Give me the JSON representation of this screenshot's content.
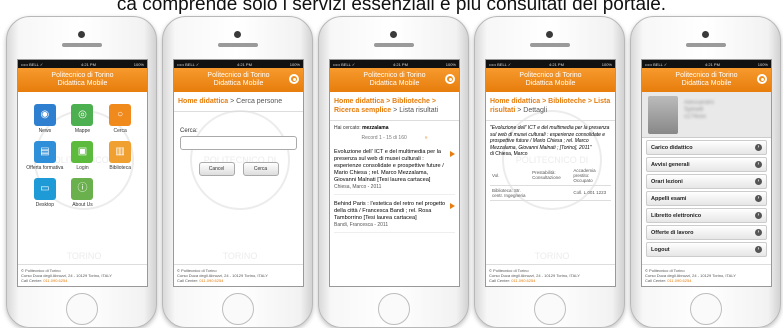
{
  "caption": "ca comprende solo i servizi essenziali e più consultati del portale.",
  "app": {
    "title_line1": "Politecnico di Torino",
    "title_line2": "Didattica Mobile"
  },
  "watermark": "POLITECNICO DI TORINO",
  "footer": {
    "line1": "© Politecnico di Torino",
    "line2": "Corso Duca degli Abruzzi, 24 - 10129 Torino, ITALY",
    "call_label": "Call Center:",
    "call_number": "011.090.6254"
  },
  "status": [
    {
      "carrier": "••••• BELL ✓",
      "time": "4:21 PM",
      "battery": "100%"
    },
    {
      "carrier": "••••• BELL ✓",
      "time": "4:21 PM",
      "battery": "100%"
    },
    {
      "carrier": "••••• BELL ✓",
      "time": "4:21 PM",
      "battery": "100%"
    },
    {
      "carrier": "••••• BELL ✓",
      "time": "4:21 PM",
      "battery": "100%"
    },
    {
      "carrier": "••••• BELL ✓",
      "time": "4:21 PM",
      "battery": "100%"
    }
  ],
  "home": {
    "tiles": [
      {
        "label": "News",
        "color": "#2f7fd1",
        "icon": "rss-icon",
        "glyph": "◉"
      },
      {
        "label": "Mappe",
        "color": "#4caf50",
        "icon": "compass-icon",
        "glyph": "◎"
      },
      {
        "label": "Cerca",
        "color": "#f08a1c",
        "icon": "search-icon",
        "glyph": "○"
      },
      {
        "label": "Offerta formativa",
        "color": "#2f8fd8",
        "icon": "document-icon",
        "glyph": "▤"
      },
      {
        "label": "Login",
        "color": "#5cbb3c",
        "icon": "lock-icon",
        "glyph": "▣"
      },
      {
        "label": "Biblioteca",
        "color": "#f0a030",
        "icon": "book-icon",
        "glyph": "▥"
      },
      {
        "label": "Desktop",
        "color": "#1e9ad6",
        "icon": "monitor-icon",
        "glyph": "▭"
      },
      {
        "label": "About Us",
        "color": "#6ab04c",
        "icon": "info-icon",
        "glyph": "ⓘ"
      }
    ]
  },
  "search": {
    "crumb_link": "Home didattica",
    "crumb_current": "> Cerca persone",
    "label": "Cerca:",
    "input_value": "",
    "cancel_label": "Cancel",
    "submit_label": "Cerca"
  },
  "results": {
    "crumb_link1": "Home didattica",
    "crumb_link2": "> Biblioteche >",
    "crumb_link3": "Ricerca semplice",
    "crumb_current": "> Lista risultati",
    "searched_label": "Hai cercato:",
    "searched_value": "mezzalama",
    "records": "Record 1 - 15 di 160",
    "items": [
      {
        "title": "Evoluzione dell' ICT e del multimedia per la presenza sul web di musei culturali : esperienze consolidate e prospettive future / Mario Chiesa ; rel. Marco Mezzalama, Giovanni Malnati [Tesi laurea cartacea]",
        "sub": "Chiesa, Marco - 2011"
      },
      {
        "title": "Behind Paris : l'estetica del retro nel progetto della città / Francesca Bandi ; rel. Rosa Tamborrino [Tesi laurea cartacea]",
        "sub": "Bandi, Francesca - 2011"
      }
    ]
  },
  "detail": {
    "crumb_link1": "Home didattica",
    "crumb_link2": "> Biblioteche >",
    "crumb_link3": "Lista risultati",
    "crumb_current": "> Dettagli",
    "text": "\"Evoluzione dell' ICT e del multimedia per la presenza sul web di musei culturali : esperienze consolidate e prospettive future / Mario Chiesa ; rel. Marco Mezzalama, Giovanni Malnati ; [Torino], 2011\"",
    "author": "di Chiesa, Marco",
    "rows": [
      [
        "Vol.",
        "Prestabilità: Consultazione",
        "Accademia prestito: Occupato"
      ],
      [
        "Biblioteca: Str. centr. Ingegneria",
        "",
        "Coll. L.001 1223"
      ]
    ]
  },
  "profile": {
    "name_line1": "Alessandro",
    "name_line2": "Spinelli",
    "name_line3": "s174xxx",
    "menu": [
      "Carico didattico",
      "Avvisi generali",
      "Orari lezioni",
      "Appelli esami",
      "Libretto elettronico",
      "Offerte di lavoro",
      "Logout"
    ]
  }
}
